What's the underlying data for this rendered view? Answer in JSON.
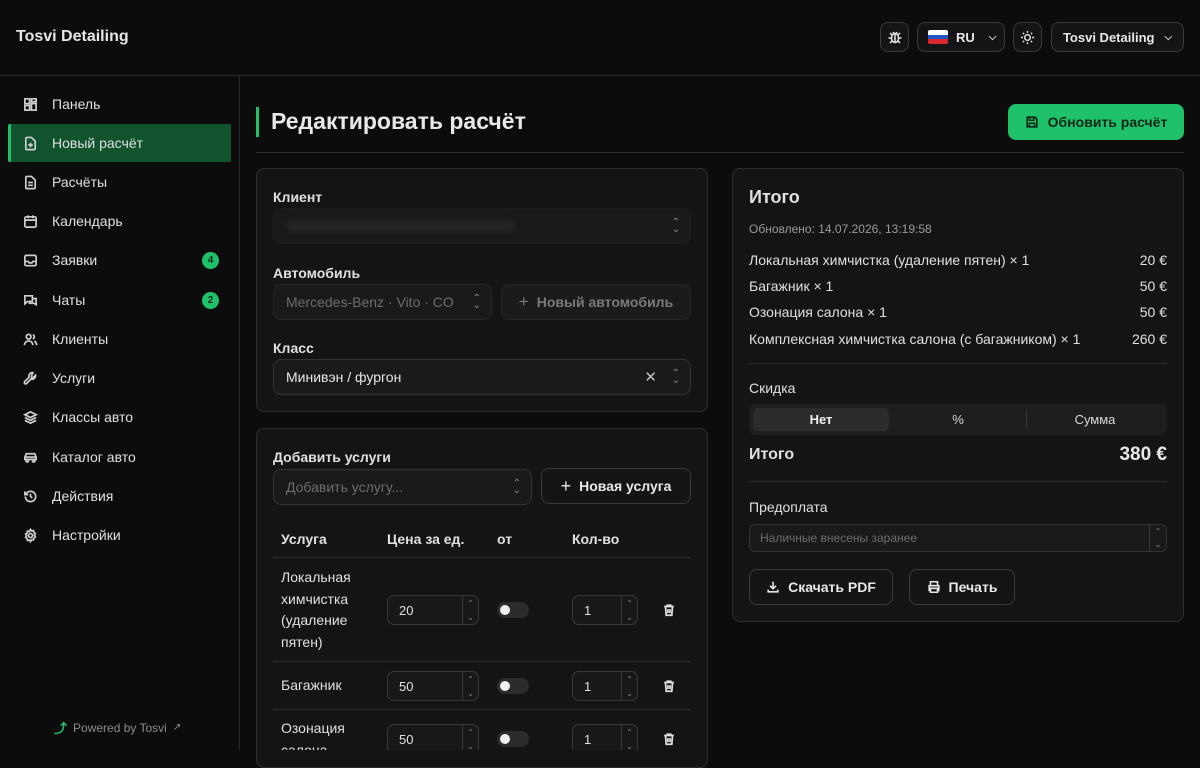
{
  "brand": "Tosvi Detailing",
  "topbar": {
    "lang": "RU",
    "account": "Tosvi Detailing",
    "bug_icon": "bug-icon",
    "theme_icon": "sun-icon"
  },
  "sidebar": {
    "items": [
      {
        "label": "Панель",
        "icon": "dashboard-icon"
      },
      {
        "label": "Новый расчёт",
        "icon": "file-plus-icon"
      },
      {
        "label": "Расчёты",
        "icon": "file-icon"
      },
      {
        "label": "Календарь",
        "icon": "calendar-icon"
      },
      {
        "label": "Заявки",
        "icon": "inbox-icon",
        "badge": "4"
      },
      {
        "label": "Чаты",
        "icon": "chat-icon",
        "badge": "2"
      },
      {
        "label": "Клиенты",
        "icon": "users-icon"
      },
      {
        "label": "Услуги",
        "icon": "wrench-icon"
      },
      {
        "label": "Классы авто",
        "icon": "layers-icon"
      },
      {
        "label": "Каталог авто",
        "icon": "car-icon"
      },
      {
        "label": "Действия",
        "icon": "history-icon"
      },
      {
        "label": "Настройки",
        "icon": "gear-icon"
      }
    ],
    "powered": "Powered by Tosvi"
  },
  "page": {
    "title": "Редактировать расчёт",
    "update_button": "Обновить расчёт"
  },
  "form": {
    "client_label": "Клиент",
    "client_value": "",
    "car_label": "Автомобиль",
    "car_value": "Mercedes-Benz · Vito · CO",
    "new_car_button": "Новый автомобиль",
    "class_label": "Класс",
    "class_value": "Минивэн / фургон"
  },
  "services": {
    "title": "Добавить услуги",
    "placeholder": "Добавить услугу...",
    "new_service_button": "Новая услуга",
    "headers": [
      "Услуга",
      "Цена за ед.",
      "от",
      "Кол-во"
    ],
    "rows": [
      {
        "name": "Локальная химчистка (удаление пятен)",
        "price": "20",
        "qty": "1"
      },
      {
        "name": "Багажник",
        "price": "50",
        "qty": "1"
      },
      {
        "name": "Озонация салона",
        "price": "50",
        "qty": "1"
      }
    ]
  },
  "summary": {
    "title": "Итого",
    "updated": "Обновлено: 14.07.2026, 13:19:58",
    "lines": [
      {
        "name": "Локальная химчистка (удаление пятен) × 1",
        "amount": "20 €"
      },
      {
        "name": "Багажник × 1",
        "amount": "50 €"
      },
      {
        "name": "Озонация салона × 1",
        "amount": "50 €"
      },
      {
        "name": "Комплексная химчистка салона (с багажником) × 1",
        "amount": "260 €"
      }
    ],
    "discount_label": "Скидка",
    "discount_options": [
      "Нет",
      "%",
      "Сумма"
    ],
    "total_label": "Итого",
    "total_value": "380 €",
    "prepay_label": "Предоплата",
    "prepay_placeholder": "Наличные внесены заранее",
    "pdf_button": "Скачать PDF",
    "print_button": "Печать"
  }
}
